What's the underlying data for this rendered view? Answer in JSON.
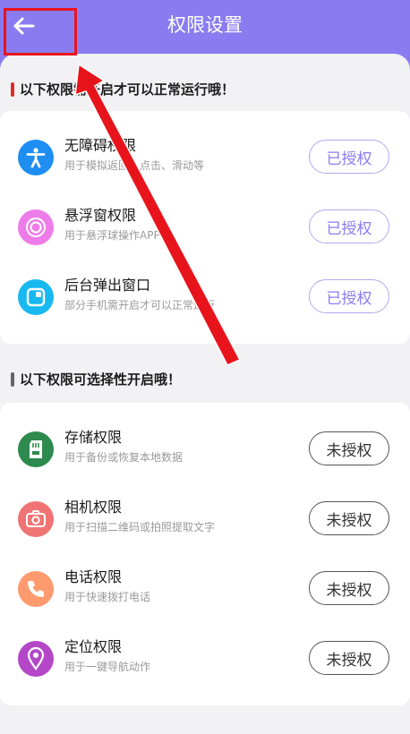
{
  "header": {
    "title": "权限设置",
    "back_icon": "arrow-left-icon",
    "background": "#8a7cf0"
  },
  "sections": [
    {
      "title": "以下权限需开启才可以正常运行哦！",
      "bar_color": "#e02c2c",
      "items": [
        {
          "title": "无障碍权限",
          "subtitle": "用于模拟返回、点击、滑动等",
          "status": "已授权",
          "granted": true,
          "icon": "accessibility-icon",
          "icon_color": "#1e8ef2"
        },
        {
          "title": "悬浮窗权限",
          "subtitle": "用于悬浮球操作APP",
          "status": "已授权",
          "granted": true,
          "icon": "floating-ball-icon",
          "icon_color": "#ee7ce8"
        },
        {
          "title": "后台弹出窗口",
          "subtitle": "部分手机需开启才可以正常运行",
          "status": "已授权",
          "granted": true,
          "icon": "popup-window-icon",
          "icon_color": "#18b9f0"
        }
      ]
    },
    {
      "title": "以下权限可选择性开启哦！",
      "bar_color": "#666666",
      "items": [
        {
          "title": "存储权限",
          "subtitle": "用于备份或恢复本地数据",
          "status": "未授权",
          "granted": false,
          "icon": "sd-card-icon",
          "icon_color": "#2e8a4e"
        },
        {
          "title": "相机权限",
          "subtitle": "用于扫描二维码或拍照提取文字",
          "status": "未授权",
          "granted": false,
          "icon": "camera-icon",
          "icon_color": "#f07474"
        },
        {
          "title": "电话权限",
          "subtitle": "用于快速拨打电话",
          "status": "未授权",
          "granted": false,
          "icon": "phone-icon",
          "icon_color": "#ff9a6e"
        },
        {
          "title": "定位权限",
          "subtitle": "用于一键导航动作",
          "status": "未授权",
          "granted": false,
          "icon": "location-pin-icon",
          "icon_color": "#b447c8"
        }
      ]
    }
  ],
  "annotation_color": "#e8141c"
}
